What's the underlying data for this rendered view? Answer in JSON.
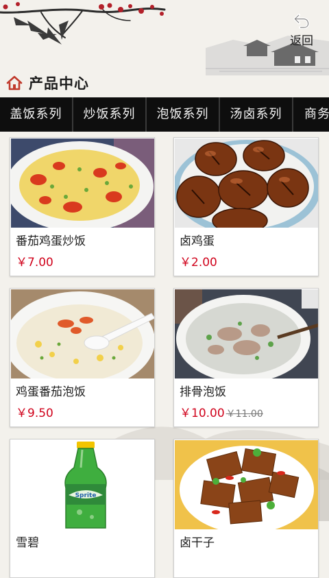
{
  "header": {
    "back_label": "返回",
    "section_title": "产品中心"
  },
  "categories": [
    "盖饭系列",
    "炒饭系列",
    "泡饭系列",
    "汤卤系列",
    "商务"
  ],
  "products": [
    {
      "name": "番茄鸡蛋炒饭",
      "price": "￥7.00",
      "old_price": "",
      "image": "tomato-egg-fried-rice-image"
    },
    {
      "name": "卤鸡蛋",
      "price": "￥2.00",
      "old_price": "",
      "image": "braised-eggs-image"
    },
    {
      "name": "鸡蛋番茄泡饭",
      "price": "￥9.50",
      "old_price": "",
      "image": "egg-tomato-rice-soup-image"
    },
    {
      "name": "排骨泡饭",
      "price": "￥10.00",
      "old_price": "￥11.00",
      "image": "pork-rib-rice-soup-image"
    },
    {
      "name": "雪碧",
      "price": "",
      "old_price": "",
      "image": "sprite-bottle-image"
    },
    {
      "name": "卤干子",
      "price": "",
      "old_price": "",
      "image": "braised-tofu-image"
    }
  ],
  "colors": {
    "category_bar_bg": "#0e0e0e",
    "price_red": "#d0021b",
    "page_bg": "#f3f1ec"
  }
}
